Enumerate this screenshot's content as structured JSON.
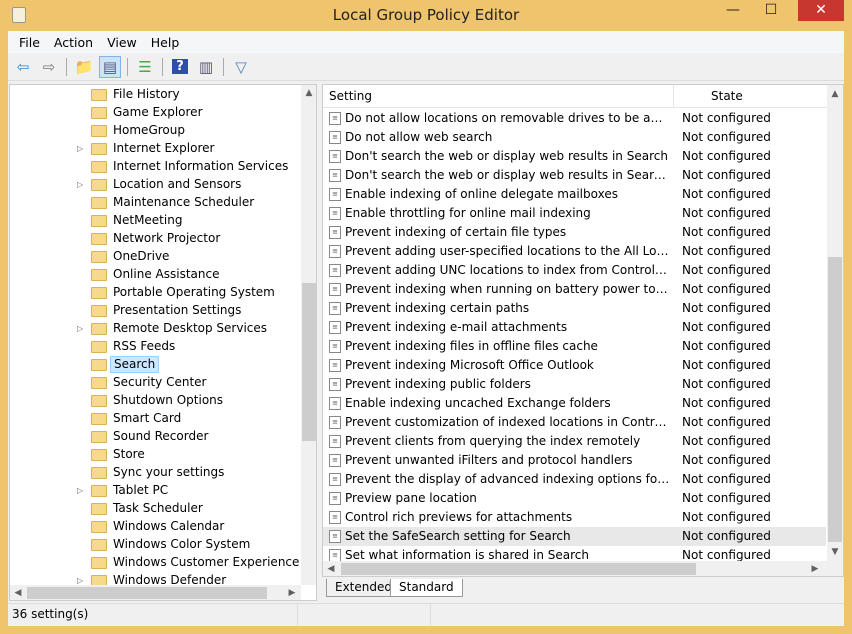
{
  "window": {
    "title": "Local Group Policy Editor",
    "minimize": "—",
    "maximize": "☐",
    "close": "✕"
  },
  "menu": [
    "File",
    "Action",
    "View",
    "Help"
  ],
  "toolbar": [
    {
      "icon": "back-arrow-icon",
      "glyph": "⇦",
      "color": "#2b8ad8"
    },
    {
      "icon": "forward-arrow-icon",
      "glyph": "⇨",
      "color": "#777"
    },
    {
      "icon": "up-folder-icon",
      "glyph": "📁",
      "color": "#d9a830"
    },
    {
      "icon": "show-hide-tree-icon",
      "glyph": "▤",
      "color": "#557",
      "selected": true
    },
    {
      "icon": "export-list-icon",
      "glyph": "☰",
      "color": "#4a4"
    },
    {
      "icon": "help-icon",
      "glyph": "?",
      "color": "#fff"
    },
    {
      "icon": "action-pane-icon",
      "glyph": "▥",
      "color": "#557"
    },
    {
      "icon": "filter-icon",
      "glyph": "▽",
      "color": "#4a7fb5"
    }
  ],
  "tree": [
    {
      "label": "File History"
    },
    {
      "label": "Game Explorer"
    },
    {
      "label": "HomeGroup"
    },
    {
      "label": "Internet Explorer",
      "expandable": true
    },
    {
      "label": "Internet Information Services"
    },
    {
      "label": "Location and Sensors",
      "expandable": true
    },
    {
      "label": "Maintenance Scheduler"
    },
    {
      "label": "NetMeeting"
    },
    {
      "label": "Network Projector"
    },
    {
      "label": "OneDrive"
    },
    {
      "label": "Online Assistance"
    },
    {
      "label": "Portable Operating System"
    },
    {
      "label": "Presentation Settings"
    },
    {
      "label": "Remote Desktop Services",
      "expandable": true
    },
    {
      "label": "RSS Feeds"
    },
    {
      "label": "Search",
      "selected": true
    },
    {
      "label": "Security Center"
    },
    {
      "label": "Shutdown Options"
    },
    {
      "label": "Smart Card"
    },
    {
      "label": "Sound Recorder"
    },
    {
      "label": "Store"
    },
    {
      "label": "Sync your settings"
    },
    {
      "label": "Tablet PC",
      "expandable": true
    },
    {
      "label": "Task Scheduler"
    },
    {
      "label": "Windows Calendar"
    },
    {
      "label": "Windows Color System"
    },
    {
      "label": "Windows Customer Experience Imp"
    },
    {
      "label": "Windows Defender",
      "expandable": true
    }
  ],
  "list": {
    "columns": [
      "Setting",
      "State"
    ],
    "rows": [
      {
        "name": "Do not allow locations on removable drives to be added to li...",
        "state": "Not configured"
      },
      {
        "name": "Do not allow web search",
        "state": "Not configured"
      },
      {
        "name": "Don't search the web or display web results in Search",
        "state": "Not configured"
      },
      {
        "name": "Don't search the web or display web results in Search over ...",
        "state": "Not configured"
      },
      {
        "name": "Enable indexing of online delegate mailboxes",
        "state": "Not configured"
      },
      {
        "name": "Enable throttling for online mail indexing",
        "state": "Not configured"
      },
      {
        "name": "Prevent indexing of certain file types",
        "state": "Not configured"
      },
      {
        "name": "Prevent adding user-specified locations to the All Locations ...",
        "state": "Not configured"
      },
      {
        "name": "Prevent adding UNC locations to index from Control Panel",
        "state": "Not configured"
      },
      {
        "name": "Prevent indexing when running on battery power to conserv...",
        "state": "Not configured"
      },
      {
        "name": "Prevent indexing certain paths",
        "state": "Not configured"
      },
      {
        "name": "Prevent indexing e-mail attachments",
        "state": "Not configured"
      },
      {
        "name": "Prevent indexing files in offline files cache",
        "state": "Not configured"
      },
      {
        "name": "Prevent indexing Microsoft Office Outlook",
        "state": "Not configured"
      },
      {
        "name": "Prevent indexing public folders",
        "state": "Not configured"
      },
      {
        "name": "Enable indexing uncached Exchange folders",
        "state": "Not configured"
      },
      {
        "name": "Prevent customization of indexed locations in Control Panel",
        "state": "Not configured"
      },
      {
        "name": "Prevent clients from querying the index remotely",
        "state": "Not configured"
      },
      {
        "name": "Prevent unwanted iFilters and protocol handlers",
        "state": "Not configured"
      },
      {
        "name": "Prevent the display of advanced indexing options for Windo...",
        "state": "Not configured"
      },
      {
        "name": "Preview pane location",
        "state": "Not configured"
      },
      {
        "name": "Control rich previews for attachments",
        "state": "Not configured"
      },
      {
        "name": "Set the SafeSearch setting for Search",
        "state": "Not configured",
        "highlighted": true
      },
      {
        "name": "Set what information is shared in Search",
        "state": "Not configured"
      }
    ]
  },
  "tabs": [
    "Extended",
    "Standard"
  ],
  "active_tab": "Standard",
  "status": "36 setting(s)"
}
